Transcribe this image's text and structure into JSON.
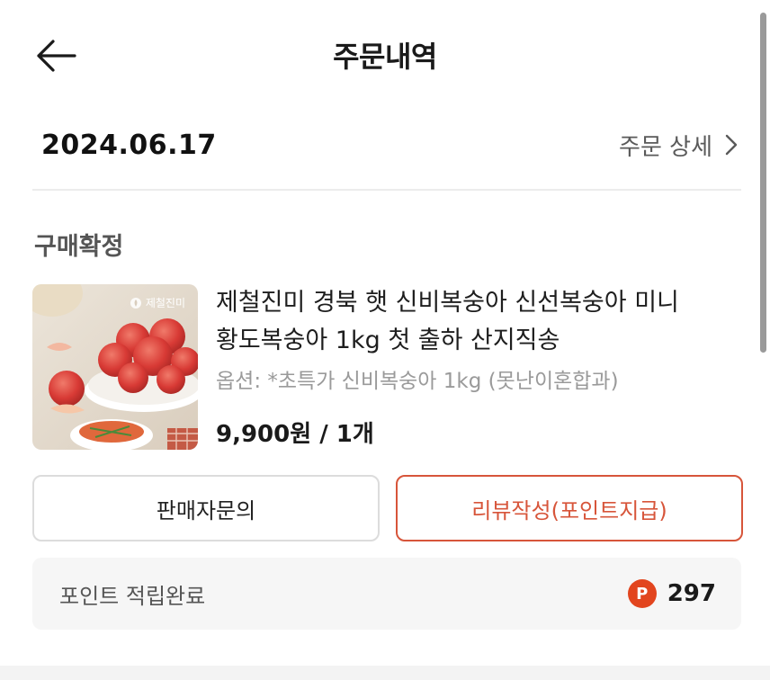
{
  "header": {
    "title": "주문내역",
    "back_icon": "arrow-left-icon"
  },
  "order": {
    "date": "2024.06.17",
    "detail_label": "주문 상세"
  },
  "status": "구매확정",
  "product": {
    "brand_badge": "제철진미",
    "name_line1": "제철진미 경북 햇 신비복숭아 신선복숭아 미니",
    "name_line2": "황도복숭아 1kg 첫 출하 산지직송",
    "option": "옵션: *초특가 신비복숭아 1kg (못난이혼합과)",
    "price": "9,900원 / 1개"
  },
  "actions": {
    "inquiry_label": "판매자문의",
    "review_label": "리뷰작성(포인트지급)"
  },
  "points": {
    "label": "포인트 적립완료",
    "badge": "P",
    "value": "297"
  },
  "colors": {
    "accent": "#d7553a",
    "points_badge": "#e2451e"
  }
}
